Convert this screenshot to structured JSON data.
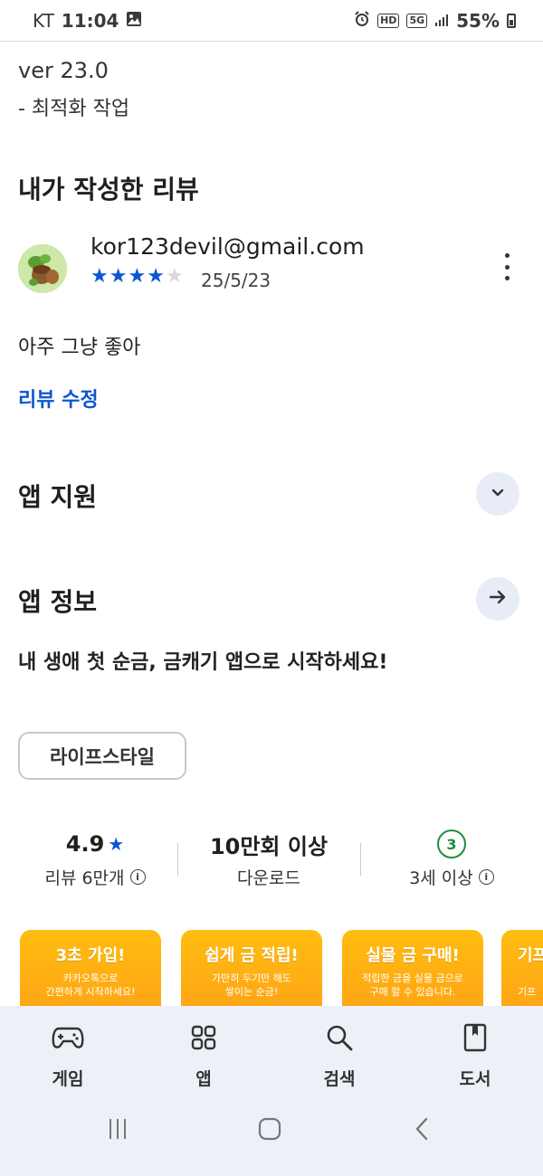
{
  "status_bar": {
    "carrier": "KT",
    "time": "11:04",
    "network_tag_1": "HD",
    "network_tag_2": "5G",
    "battery": "55%"
  },
  "whats_new": {
    "version": "ver 23.0",
    "note": "- 최적화 작업"
  },
  "my_review": {
    "title": "내가 작성한 리뷰",
    "email": "kor123devil@gmail.com",
    "rating": 4,
    "max_rating": 5,
    "date": "25/5/23",
    "text": "아주 그냥 좋아",
    "edit_label": "리뷰 수정"
  },
  "app_support": {
    "title": "앱 지원"
  },
  "app_info": {
    "title": "앱 정보",
    "tagline": "내 생애 첫 순금, 금캐기 앱으로 시작하세요!",
    "category": "라이프스타일"
  },
  "stats": {
    "rating_value": "4.9",
    "rating_label": "리뷰 6만개",
    "downloads_value": "10만회 이상",
    "downloads_label": "다운로드",
    "age_badge": "3",
    "age_label": "3세 이상"
  },
  "screenshots": [
    {
      "title": "3초 가입!",
      "sub1": "카카오톡으로",
      "sub2": "간편하게 시작하세요!"
    },
    {
      "title": "쉽게 금 적립!",
      "sub1": "가만히 두기만 해도",
      "sub2": "쌓이는 순금!"
    },
    {
      "title": "실물 금 구매!",
      "sub1": "적립한 금을 실물 금으로",
      "sub2": "구매 할 수 있습니다."
    },
    {
      "title": "기프",
      "sub1": "",
      "sub2": "기프"
    }
  ],
  "bottom_nav": {
    "games": "게임",
    "apps": "앱",
    "search": "검색",
    "books": "도서"
  },
  "colors": {
    "accent_blue": "#0b57d0",
    "green": "#1e8e3e",
    "orange_top": "#ffbd0f",
    "nav_bg": "#edf0f7"
  }
}
